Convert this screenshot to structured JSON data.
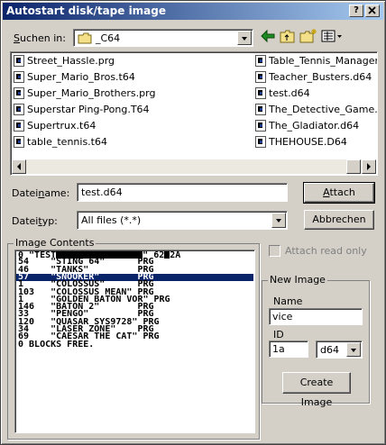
{
  "window": {
    "title": "Autostart disk/tape image",
    "help_label": "?",
    "close_label": "x"
  },
  "lookin": {
    "label_pre": "",
    "label_u": "S",
    "label_post": "uchen in:",
    "value": "_C64"
  },
  "toolbar": {
    "back_icon": "arrow-left-icon",
    "up_icon": "folder-up-icon",
    "new_icon": "new-folder-icon",
    "view_icon": "view-menu-icon"
  },
  "files": {
    "col1": [
      "Street_Hassle.prg",
      "Super_Mario_Bros.t64",
      "Super_Mario_Brothers.prg",
      "Superstar Ping-Pong.T64",
      "Supertrux.t64",
      "table_tennis.t64"
    ],
    "col2": [
      "Table_Tennis_Manager.d",
      "Teacher_Busters.d64",
      "test.d64",
      "The_Detective_Game.prg",
      "The_Gladiator.d64",
      "THEHOUSE.D64"
    ]
  },
  "filename": {
    "label_pre": "Datei",
    "label_u": "n",
    "label_post": "ame:",
    "value": "test.d64"
  },
  "filetype": {
    "label_pre": "Datei",
    "label_u": "t",
    "label_post": "yp:",
    "value": "All files (*.*)"
  },
  "buttons": {
    "attach_u": "A",
    "attach_rest": "ttach",
    "cancel": "Abbrechen",
    "create": "Create Image"
  },
  "image_contents": {
    "label": "Image Contents",
    "header_pre": "0 \"TEST",
    "header_post": "\" 62",
    "header_end": "2A",
    "rows": [
      "54    \"STING 64\"      PRG",
      "46    \"TANKS\"         PRG",
      "57    \"SNOOKER\"       PRG",
      "1     \"COLOSSUS\"      PRG",
      "103   \"COLOSSUS MEAN\" PRG",
      "1     \"GOLDEN BATON VOR\" PRG",
      "146   \"BATON 2\"       PRG",
      "33    \"PENGO\"         PRG",
      "120   \"QUASAR SYS9728\" PRG",
      "34    \"LASER ZONE\"    PRG",
      "69    \"CAESAR THE CAT\" PRG",
      "0 BLOCKS FREE."
    ],
    "selected_row": 2
  },
  "attach_readonly": {
    "label": "Attach read only",
    "checked": false
  },
  "new_image": {
    "group_label": "New Image",
    "name_label": "Name",
    "name_value": "vice",
    "id_label": "ID",
    "id_value": "1a",
    "type_value": "d64"
  },
  "colors": {
    "selection": "#0a246a",
    "title_gradient_end": "#a6caf0",
    "face": "#d4d0c8"
  }
}
